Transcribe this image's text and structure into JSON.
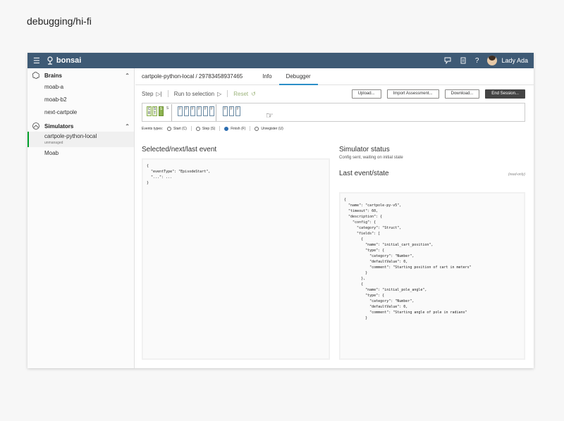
{
  "page_caption": "debugging/hi-fi",
  "topbar": {
    "brand": "bonsai",
    "user_name": "Lady Ada",
    "icons": [
      "menu-icon",
      "bonsai-logo-icon",
      "feedback-icon",
      "document-icon",
      "help-icon",
      "avatar"
    ],
    "help_glyph": "?"
  },
  "sidebar": {
    "brains_label": "Brains",
    "brains": [
      "moab-a",
      "moab-b2",
      "next-cartpole"
    ],
    "simulators_label": "Simulators",
    "simulators": [
      {
        "label": "cartpole-python-local",
        "sub": "unmanaged"
      },
      {
        "label": "Moab",
        "sub": ""
      }
    ]
  },
  "header": {
    "breadcrumb": "cartpole-python-local / 29783458937465",
    "tabs": [
      "Info",
      "Debugger"
    ],
    "active_tab": "Debugger"
  },
  "toolbar": {
    "step": "Step",
    "run_to_selection": "Run to selection",
    "reset": "Reset",
    "upload": "Upload...",
    "import_assessment": "Import Assessment...",
    "download": "Download...",
    "end_session": "End Session..."
  },
  "timeline": {
    "events": [
      "C R",
      "S T",
      "S",
      "S",
      "F",
      "F",
      "F",
      "F",
      "F",
      "F",
      "F",
      "F",
      "F",
      "F"
    ]
  },
  "legend": {
    "label": "Events types:",
    "items": [
      "Start (C)",
      "Step (S)",
      "Finish (F)",
      "Unregister (U)"
    ],
    "selected": "Finish (F)"
  },
  "left_panel": {
    "title": "Selected/next/last event",
    "code": "{\n  \"eventType\": \"EpisodeStart\",\n  \"...\": ...\n}"
  },
  "right_panel": {
    "status_title": "Simulator status",
    "status_text": "Config sent, waiting on initial state",
    "last_title": "Last event/state",
    "read_only": "(read-only)",
    "code": "{\n  \"name\": \"cartpole-py-v5\",\n  \"timeout\": 60,\n  \"description\": {\n    \"config\": {\n      \"category\": \"Struct\",\n      \"fields\": [\n        {\n          \"name\": \"initial_cart_position\",\n          \"type\": {\n            \"category\": \"Number\",\n            \"defaultValue\": 0,\n            \"comment\": \"Starting position of cart in meters\"\n          }\n        },\n        {\n          \"name\": \"initial_pole_angle\",\n          \"type\": {\n            \"category\": \"Number\",\n            \"defaultValue\": 0,\n            \"comment\": \"Starting angle of pole in radians\"\n          }"
  }
}
